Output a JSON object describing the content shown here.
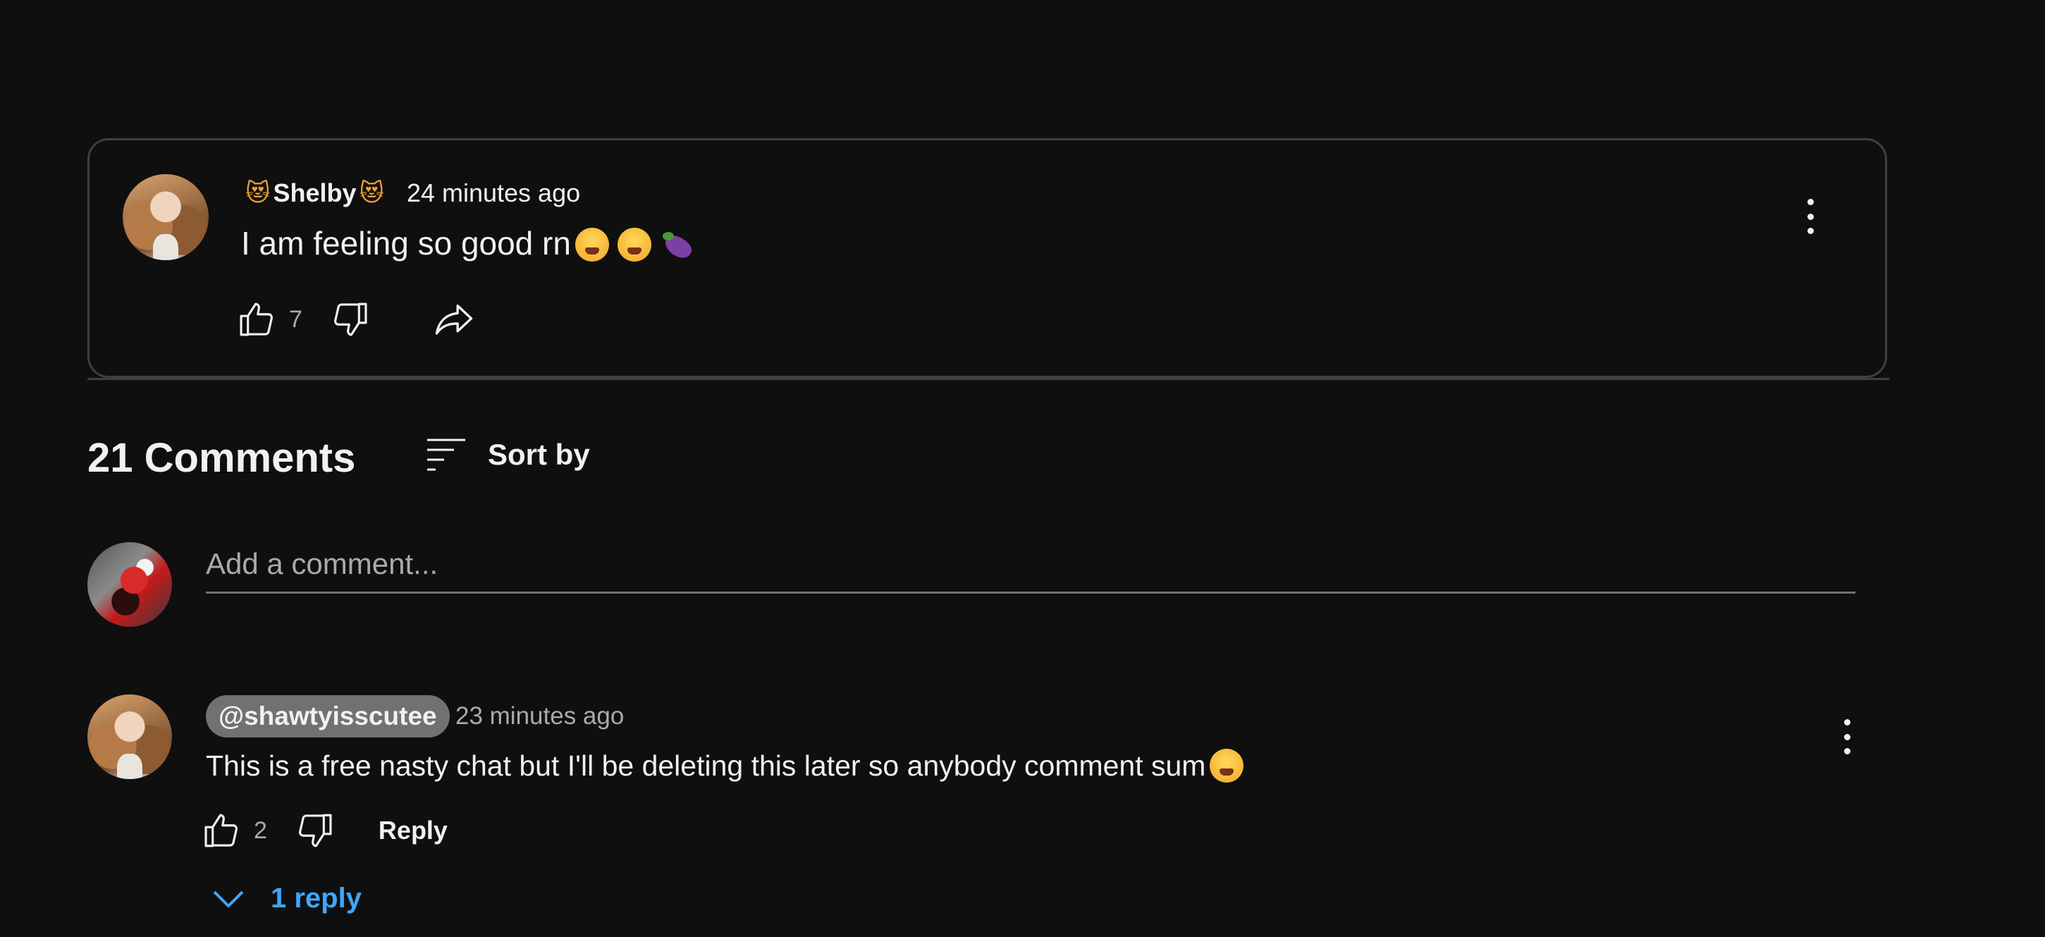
{
  "post": {
    "author_name": "Shelby",
    "author_prefix_emoji": "😻",
    "author_suffix_emoji": "😻",
    "timestamp": "24 minutes ago",
    "text": "I am feeling so good rn",
    "text_emojis": [
      "tired-face",
      "tired-face",
      "eggplant"
    ],
    "like_count": "7",
    "more_options_icon": "vertical-dots-icon"
  },
  "comments_header": {
    "count_label": "21 Comments",
    "sort_label": "Sort by"
  },
  "add_comment": {
    "placeholder": "Add a comment..."
  },
  "comment": {
    "handle": "@shawtyisscutee",
    "timestamp": "23 minutes ago",
    "text": "This is a free nasty chat but I'll be deleting this later so anybody comment sum",
    "text_emoji": "weary-face",
    "like_count": "2",
    "reply_label": "Reply",
    "replies_label": "1 reply"
  },
  "colors": {
    "background": "#0f0f0f",
    "border": "#3f3f3f",
    "primary_text": "#f1f1f1",
    "secondary_text": "#aaaaaa",
    "link_blue": "#3ea6ff",
    "handle_chip": "#717171"
  }
}
